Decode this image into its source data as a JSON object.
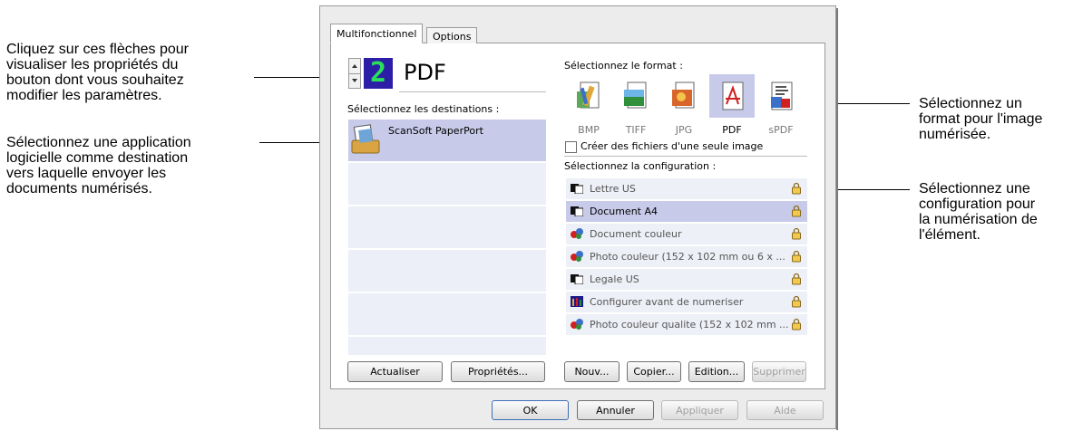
{
  "callouts": {
    "arrows": [
      "Cliquez sur ces flèches pour",
      "visualiser les propriétés du",
      "bouton dont vous souhaitez",
      "modifier les paramètres."
    ],
    "application": [
      "Sélectionnez une application",
      "logicielle comme destination",
      "vers laquelle envoyer les",
      "documents numérisés."
    ],
    "format": [
      "Sélectionnez un",
      "format pour l'image",
      "numérisée."
    ],
    "config": [
      "Sélectionnez une",
      "configuration pour",
      "la numérisation de",
      "l'élément."
    ]
  },
  "tabs": {
    "multifunction": "Multifonctionnel",
    "options": "Options"
  },
  "button_selector": {
    "number": "2",
    "format_name": "PDF"
  },
  "destinations": {
    "label": "Sélectionnez les destinations :",
    "items": [
      {
        "name": "ScanSoft PaperPort",
        "icon": "paperport-icon"
      }
    ]
  },
  "format_section": {
    "label": "Sélectionnez le format :",
    "formats": [
      {
        "name": "BMP",
        "icon": "bmp-icon"
      },
      {
        "name": "TIFF",
        "icon": "tiff-icon"
      },
      {
        "name": "JPG",
        "icon": "jpg-icon"
      },
      {
        "name": "PDF",
        "icon": "pdf-icon",
        "selected": true
      },
      {
        "name": "sPDF",
        "icon": "spdf-icon"
      }
    ],
    "single_image_label": "Créer des fichiers d'une seule image",
    "single_image_checked": false
  },
  "config_section": {
    "label": "Sélectionnez la configuration :",
    "items": [
      {
        "name": "Lettre US",
        "icon": "bw-scan-icon",
        "selected": false
      },
      {
        "name": "Document A4",
        "icon": "bw-scan-icon",
        "selected": true
      },
      {
        "name": "Document couleur",
        "icon": "color-scan-icon",
        "selected": false
      },
      {
        "name": "Photo couleur (152 x 102 mm ou 6 x ...",
        "icon": "color-scan-icon",
        "selected": false
      },
      {
        "name": "Legale US",
        "icon": "bw-scan-icon",
        "selected": false
      },
      {
        "name": "Configurer avant de numeriser",
        "icon": "configure-icon",
        "selected": false
      },
      {
        "name": "Photo couleur qualite (152 x 102 mm ...",
        "icon": "color-scan-icon",
        "selected": false
      }
    ]
  },
  "left_buttons": {
    "refresh": "Actualiser",
    "properties": "Propriétés..."
  },
  "config_buttons": {
    "new": "Nouv...",
    "copy": "Copier...",
    "edit": "Edition...",
    "delete": "Supprimer"
  },
  "dialog_buttons": {
    "ok": "OK",
    "cancel": "Annuler",
    "apply": "Appliquer",
    "help": "Aide"
  },
  "colors": {
    "selection": "#c7cbe9",
    "lcd_bg": "#2d1ea8",
    "lcd_digit": "#29e05a"
  }
}
